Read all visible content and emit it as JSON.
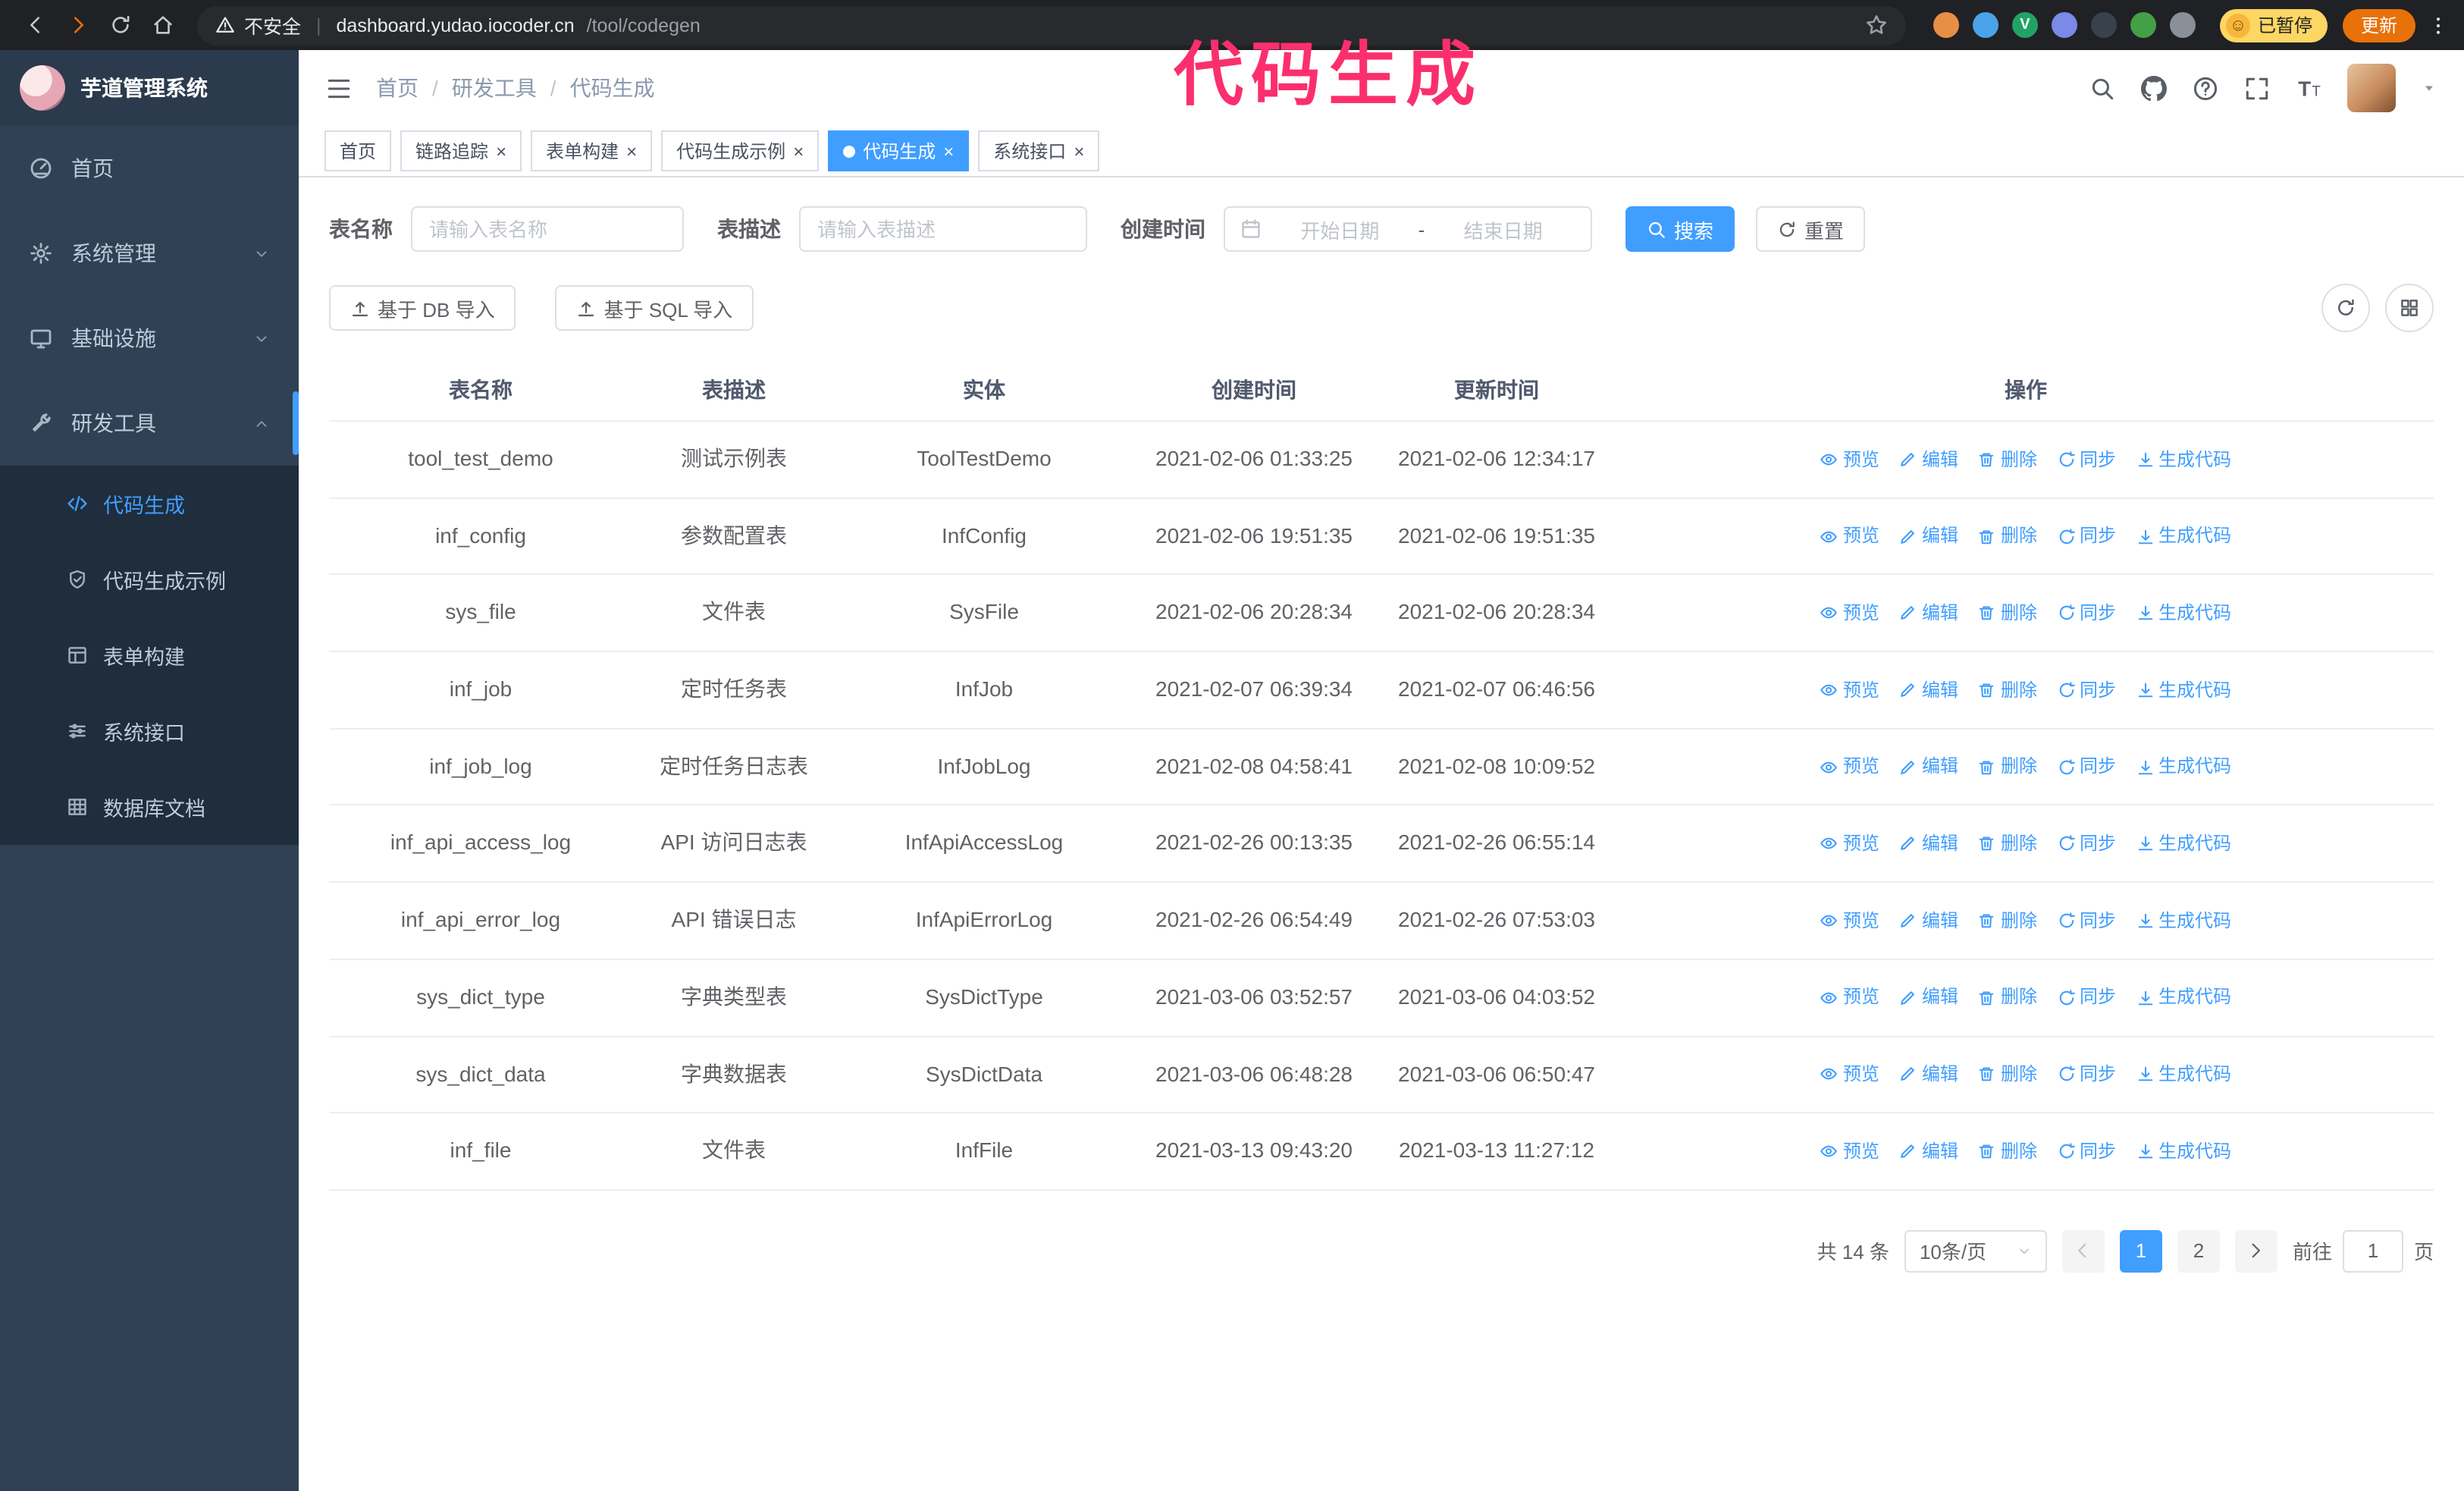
{
  "annotation": {
    "text": "代码生成",
    "color": "#fb2f6e"
  },
  "browser": {
    "nav_icons": [
      {
        "icon": "back"
      },
      {
        "icon": "forward",
        "accent": true
      },
      {
        "icon": "reload"
      },
      {
        "icon": "home"
      }
    ],
    "insecure_label": "不安全",
    "url_host": "dashboard.yudao.iocoder.cn",
    "url_path": "/tool/codegen",
    "extensions": [
      {
        "color": "#e98e45"
      },
      {
        "color": "#4aa3e8"
      },
      {
        "color": "#21a366",
        "letter": "V"
      },
      {
        "color": "#7b89e8"
      },
      {
        "color": "#39424a"
      },
      {
        "color": "#43a047"
      },
      {
        "color": "#8a9097"
      }
    ],
    "paused_badge": "已暂停",
    "update_button": "更新"
  },
  "sidebar": {
    "logo_title": "芋道管理系统",
    "items": [
      {
        "label": "首页",
        "icon": "dashboard"
      },
      {
        "label": "系统管理",
        "icon": "gear",
        "chevron": "chev-down"
      },
      {
        "label": "基础设施",
        "icon": "monitor",
        "chevron": "chev-down"
      },
      {
        "label": "研发工具",
        "icon": "tools",
        "chevron": "chev-up",
        "active_parent": true
      }
    ],
    "subitems": [
      {
        "label": "代码生成",
        "icon": "code",
        "active": true
      },
      {
        "label": "代码生成示例",
        "icon": "shield"
      },
      {
        "label": "表单构建",
        "icon": "form"
      },
      {
        "label": "系统接口",
        "icon": "sliders"
      },
      {
        "label": "数据库文档",
        "icon": "grid-table"
      }
    ]
  },
  "header": {
    "breadcrumb": [
      {
        "label": "首页",
        "sep": true
      },
      {
        "label": "研发工具",
        "sep": true
      },
      {
        "label": "代码生成"
      }
    ],
    "tools": [
      {
        "icon": "magnifier"
      },
      {
        "icon": "github"
      },
      {
        "icon": "question"
      },
      {
        "icon": "fullscreen"
      },
      {
        "icon": "fontsize"
      }
    ]
  },
  "tabs": [
    {
      "label": "首页"
    },
    {
      "label": "链路追踪",
      "closable": true
    },
    {
      "label": "表单构建",
      "closable": true
    },
    {
      "label": "代码生成示例",
      "closable": true
    },
    {
      "label": "代码生成",
      "closable": true,
      "active": true
    },
    {
      "label": "系统接口",
      "closable": true
    }
  ],
  "filters": {
    "table_name_label": "表名称",
    "table_name_placeholder": "请输入表名称",
    "table_desc_label": "表描述",
    "table_desc_placeholder": "请输入表描述",
    "create_time_label": "创建时间",
    "start_date_placeholder": "开始日期",
    "range_separator": "-",
    "end_date_placeholder": "结束日期",
    "search_label": "搜索",
    "reset_label": "重置"
  },
  "toolbar": {
    "import_db_label": "基于 DB 导入",
    "import_sql_label": "基于 SQL 导入",
    "icon_buttons": [
      {
        "icon": "refresh"
      },
      {
        "icon": "grid"
      }
    ]
  },
  "table": {
    "columns": [
      "表名称",
      "表描述",
      "实体",
      "创建时间",
      "更新时间",
      "操作"
    ],
    "actions": [
      {
        "label": "预览",
        "icon": "eye"
      },
      {
        "label": "编辑",
        "icon": "edit"
      },
      {
        "label": "删除",
        "icon": "delete"
      },
      {
        "label": "同步",
        "icon": "sync"
      },
      {
        "label": "生成代码",
        "icon": "download"
      }
    ],
    "rows": [
      {
        "name": "tool_test_demo",
        "desc": "测试示例表",
        "entity": "ToolTestDemo",
        "created": "2021-02-06 01:33:25",
        "updated": "2021-02-06 12:34:17"
      },
      {
        "name": "inf_config",
        "desc": "参数配置表",
        "entity": "InfConfig",
        "created": "2021-02-06 19:51:35",
        "updated": "2021-02-06 19:51:35"
      },
      {
        "name": "sys_file",
        "desc": "文件表",
        "entity": "SysFile",
        "created": "2021-02-06 20:28:34",
        "updated": "2021-02-06 20:28:34"
      },
      {
        "name": "inf_job",
        "desc": "定时任务表",
        "entity": "InfJob",
        "created": "2021-02-07 06:39:34",
        "updated": "2021-02-07 06:46:56"
      },
      {
        "name": "inf_job_log",
        "desc": "定时任务日志表",
        "entity": "InfJobLog",
        "created": "2021-02-08 04:58:41",
        "updated": "2021-02-08 10:09:52"
      },
      {
        "name": "inf_api_access_log",
        "desc": "API 访问日志表",
        "entity": "InfApiAccessLog",
        "created": "2021-02-26 00:13:35",
        "updated": "2021-02-26 06:55:14"
      },
      {
        "name": "inf_api_error_log",
        "desc": "API 错误日志",
        "entity": "InfApiErrorLog",
        "created": "2021-02-26 06:54:49",
        "updated": "2021-02-26 07:53:03"
      },
      {
        "name": "sys_dict_type",
        "desc": "字典类型表",
        "entity": "SysDictType",
        "created": "2021-03-06 03:52:57",
        "updated": "2021-03-06 04:03:52"
      },
      {
        "name": "sys_dict_data",
        "desc": "字典数据表",
        "entity": "SysDictData",
        "created": "2021-03-06 06:48:28",
        "updated": "2021-03-06 06:50:47"
      },
      {
        "name": "inf_file",
        "desc": "文件表",
        "entity": "InfFile",
        "created": "2021-03-13 09:43:20",
        "updated": "2021-03-13 11:27:12"
      }
    ]
  },
  "pagination": {
    "total_label": "共 14 条",
    "page_size_value": "10条/页",
    "pages": [
      {
        "label": "1",
        "active": true
      },
      {
        "label": "2"
      }
    ],
    "goto_label": "前往",
    "goto_value": "1",
    "page_unit": "页"
  }
}
